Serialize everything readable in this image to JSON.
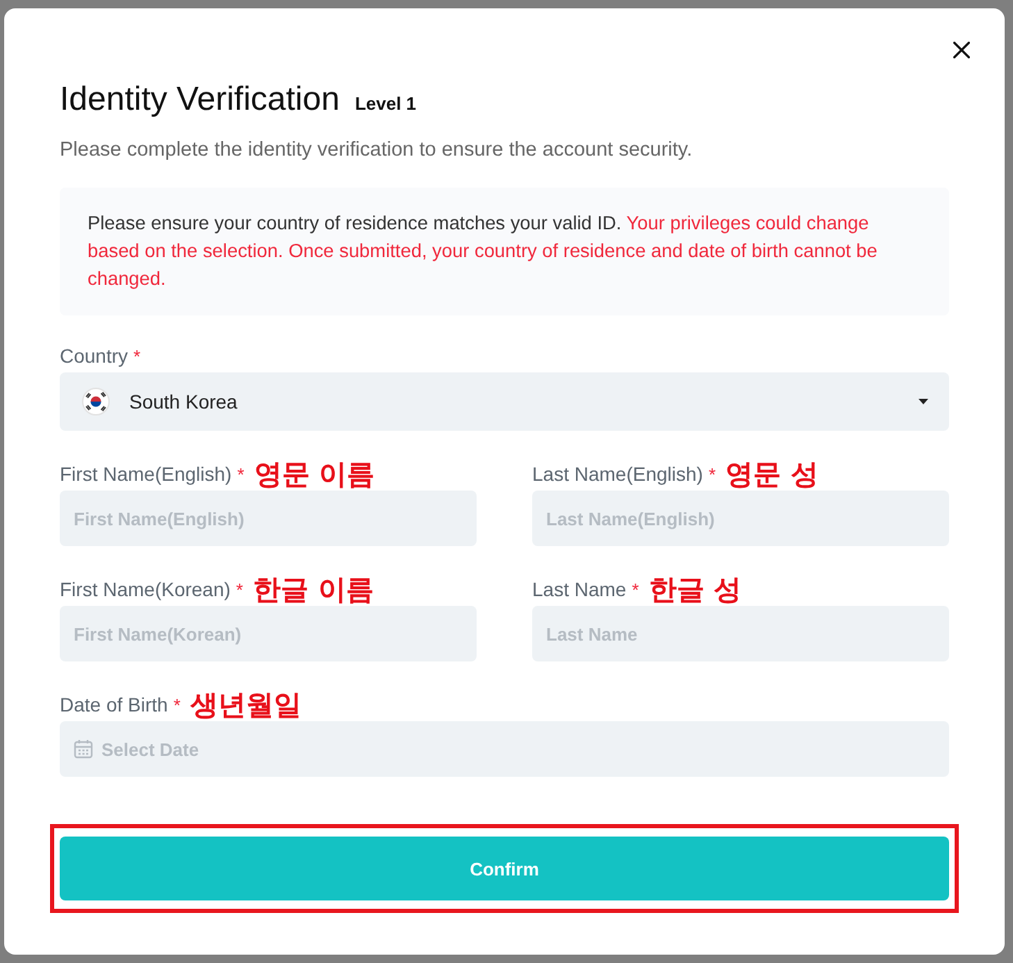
{
  "dialog": {
    "title": "Identity Verification",
    "level": "Level 1",
    "subtitle": "Please complete the identity verification to ensure the account security."
  },
  "notice": [
    {
      "kind": "info",
      "text": "Please ensure your country of residence matches your valid ID."
    },
    {
      "kind": "warning",
      "text": "Your privileges could change based on the selection. Once submitted, your country of residence and date of birth cannot be changed."
    }
  ],
  "form": {
    "rows": [
      {
        "fields": [
          {
            "kind": "select",
            "label": "Country",
            "required_mark": "*",
            "value": "South Korea"
          }
        ]
      },
      {
        "fields": [
          {
            "kind": "text",
            "label": "First Name(English)",
            "required_mark": "*",
            "annotation": "영문 이름",
            "placeholder": "First Name(English)"
          },
          {
            "kind": "text",
            "label": "Last Name(English)",
            "required_mark": "*",
            "annotation": "영문 성",
            "placeholder": "Last Name(English)"
          }
        ]
      },
      {
        "fields": [
          {
            "kind": "text",
            "label": "First Name(Korean)",
            "required_mark": "*",
            "annotation": "한글 이름",
            "placeholder": "First Name(Korean)"
          },
          {
            "kind": "text",
            "label": "Last Name",
            "required_mark": "*",
            "annotation": "한글 성",
            "placeholder": "Last Name"
          }
        ]
      },
      {
        "fields": [
          {
            "kind": "date",
            "label": "Date of Birth",
            "required_mark": "*",
            "annotation": "생년월일",
            "placeholder": "Select Date"
          }
        ]
      }
    ]
  },
  "submit": {
    "label": "Confirm",
    "highlighted": true
  }
}
